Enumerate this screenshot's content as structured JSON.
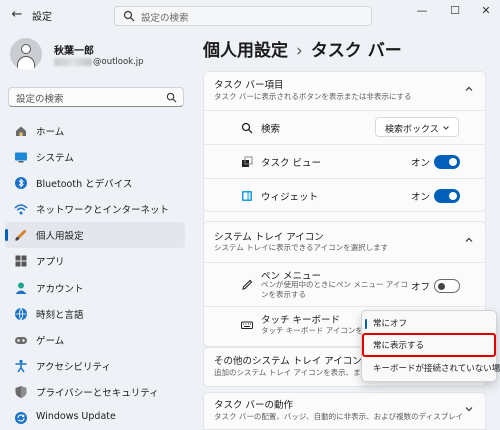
{
  "titlebar": {
    "app_title": "設定",
    "search_placeholder": "設定の検索",
    "minimize": "—",
    "maximize": "☐",
    "close": "✕"
  },
  "user": {
    "name": "秋葉一郎",
    "email_suffix": "@outlook.jp"
  },
  "sidebar": {
    "search_placeholder": "設定の検索",
    "items": [
      {
        "label": "ホーム",
        "icon": "home-icon"
      },
      {
        "label": "システム",
        "icon": "system-icon"
      },
      {
        "label": "Bluetooth とデバイス",
        "icon": "bluetooth-icon"
      },
      {
        "label": "ネットワークとインターネット",
        "icon": "network-icon"
      },
      {
        "label": "個人用設定",
        "icon": "personalization-icon",
        "active": true
      },
      {
        "label": "アプリ",
        "icon": "apps-icon"
      },
      {
        "label": "アカウント",
        "icon": "accounts-icon"
      },
      {
        "label": "時刻と言語",
        "icon": "time-language-icon"
      },
      {
        "label": "ゲーム",
        "icon": "gaming-icon"
      },
      {
        "label": "アクセシビリティ",
        "icon": "accessibility-icon"
      },
      {
        "label": "プライバシーとセキュリティ",
        "icon": "privacy-icon"
      },
      {
        "label": "Windows Update",
        "icon": "windows-update-icon"
      }
    ]
  },
  "breadcrumb": {
    "parent": "個人用設定",
    "separator": "›",
    "current": "タスク バー"
  },
  "taskbar_items": {
    "title": "タスク バー項目",
    "subtitle": "タスク バーに表示されるボタンを表示または非表示にする",
    "rows": [
      {
        "label": "検索",
        "control": "dropdown",
        "value": "検索ボックス"
      },
      {
        "label": "タスク ビュー",
        "control": "toggle",
        "state": "オン"
      },
      {
        "label": "ウィジェット",
        "control": "toggle",
        "state": "オン"
      }
    ]
  },
  "system_tray": {
    "title": "システム トレイ アイコン",
    "subtitle": "システム トレイに表示できるアイコンを選択します",
    "pen_menu": {
      "label": "ペン メニュー",
      "sub": "ペンが使用中のときにペン メニュー アイコンを表示する",
      "state": "オフ"
    },
    "touch_keyboard": {
      "label": "タッチ キーボード",
      "sub": "タッチ キーボード アイコンを表示"
    }
  },
  "other_tray": {
    "title": "その他のシステム トレイ アイコン",
    "subtitle": "追加のシステム トレイ アイコンを表示、または非表示"
  },
  "taskbar_behavior": {
    "title": "タスク バーの動作",
    "subtitle": "タスク バーの配置、バッジ、自動的に非表示、および複数のディスプレイ"
  },
  "flyout": {
    "options": [
      "常にオフ",
      "常に表示する",
      "キーボードが接続されていない場合"
    ],
    "selected": "常にオフ",
    "highlighted": "常に表示する"
  },
  "colors": {
    "accent": "#005fb8",
    "highlight": "#e00000"
  }
}
